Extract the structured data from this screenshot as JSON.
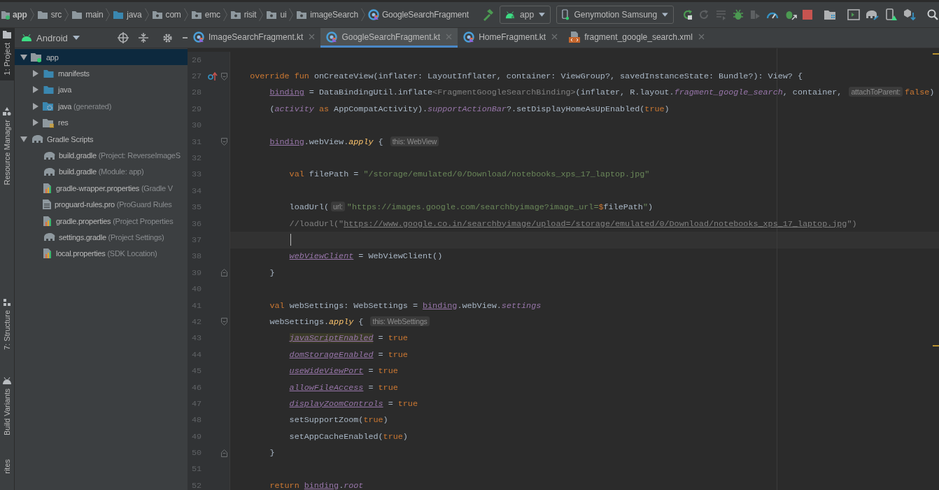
{
  "breadcrumbs": [
    {
      "label": "app",
      "kind": "module"
    },
    {
      "label": "src",
      "kind": "folder"
    },
    {
      "label": "main",
      "kind": "folder"
    },
    {
      "label": "java",
      "kind": "source"
    },
    {
      "label": "com",
      "kind": "package"
    },
    {
      "label": "emc",
      "kind": "package"
    },
    {
      "label": "risit",
      "kind": "package"
    },
    {
      "label": "ui",
      "kind": "package"
    },
    {
      "label": "imageSearch",
      "kind": "package"
    },
    {
      "label": "GoogleSearchFragment",
      "kind": "kotlin"
    }
  ],
  "toolbar": {
    "run_config": "app",
    "device": "Genymotion Samsung"
  },
  "side_tabs": [
    {
      "label": "1: Project",
      "kind": "project",
      "selected": true
    },
    {
      "label": "Resource Manager",
      "kind": "resources",
      "selected": false
    },
    {
      "label": "7: Structure",
      "kind": "structure",
      "selected": false
    },
    {
      "label": "Build Variants",
      "kind": "variants",
      "selected": false
    },
    {
      "label": "rites",
      "kind": "none",
      "selected": false
    }
  ],
  "project_view": {
    "title": "Android"
  },
  "tree": [
    {
      "label": "app",
      "kind": "module",
      "expanded": true,
      "selected": true,
      "children": [
        {
          "label": "manifests",
          "kind": "folder",
          "expanded": false,
          "selected": false
        },
        {
          "label": "java",
          "kind": "folder",
          "expanded": false,
          "selected": false
        },
        {
          "label": "java",
          "note": "(generated)",
          "kind": "generated",
          "expanded": false,
          "selected": false
        },
        {
          "label": "res",
          "kind": "res",
          "expanded": false,
          "selected": false
        }
      ]
    },
    {
      "label": "Gradle Scripts",
      "kind": "gradle",
      "expanded": true,
      "selected": false,
      "children": [
        {
          "label": "build.gradle",
          "note": "(Project: ReverseImageS",
          "kind": "gradle",
          "selected": false
        },
        {
          "label": "build.gradle",
          "note": "(Module: app)",
          "kind": "gradle",
          "selected": false
        },
        {
          "label": "gradle-wrapper.properties",
          "note": "(Gradle V",
          "kind": "properties",
          "selected": false
        },
        {
          "label": "proguard-rules.pro",
          "note": "(ProGuard Rules",
          "kind": "file",
          "selected": false
        },
        {
          "label": "gradle.properties",
          "note": "(Project Properties",
          "kind": "properties",
          "selected": false
        },
        {
          "label": "settings.gradle",
          "note": "(Project Settings)",
          "kind": "gradle",
          "selected": false
        },
        {
          "label": "local.properties",
          "note": "(SDK Location)",
          "kind": "properties",
          "selected": false
        }
      ]
    }
  ],
  "editor_tabs": [
    {
      "label": "ImageSearchFragment.kt",
      "kind": "kotlin",
      "selected": false
    },
    {
      "label": "GoogleSearchFragment.kt",
      "kind": "kotlin",
      "selected": true
    },
    {
      "label": "HomeFragment.kt",
      "kind": "kotlin",
      "selected": false
    },
    {
      "label": "fragment_google_search.xml",
      "kind": "xml",
      "selected": false
    }
  ],
  "code_lines": [
    {
      "number": "26"
    },
    {
      "number": "27",
      "override_marker": true,
      "fold_start": true,
      "tokens": [
        {
          "kind": "keyword",
          "text": "override fun "
        },
        {
          "kind": "plain",
          "text": "onCreateView(inflater: LayoutInflater, container: ViewGroup?, savedInstanceState: Bundle?): View? {"
        }
      ]
    },
    {
      "number": "28",
      "tokens": [
        {
          "kind": "field",
          "text": "binding"
        },
        {
          "kind": "plain",
          "text": " = DataBindingUtil.inflate"
        },
        {
          "kind": "grey",
          "text": "<FragmentGoogleSearchBinding>"
        },
        {
          "kind": "plain",
          "text": "(inflater, R.layout."
        },
        {
          "kind": "italic",
          "text": "fragment_google_search"
        },
        {
          "kind": "plain",
          "text": ", container, "
        },
        {
          "kind": "hint",
          "text": "attachToParent:"
        },
        {
          "kind": "keyword",
          "text": "false"
        },
        {
          "kind": "plain",
          "text": ")"
        }
      ]
    },
    {
      "number": "29",
      "tokens": [
        {
          "kind": "plain",
          "text": "("
        },
        {
          "kind": "italic",
          "text": "activity"
        },
        {
          "kind": "keyword",
          "text": " as "
        },
        {
          "kind": "plain",
          "text": "AppCompatActivity)."
        },
        {
          "kind": "italic",
          "text": "supportActionBar"
        },
        {
          "kind": "plain",
          "text": "?.setDisplayHomeAsUpEnabled("
        },
        {
          "kind": "keyword",
          "text": "true"
        },
        {
          "kind": "plain",
          "text": ")"
        }
      ]
    },
    {
      "number": "30"
    },
    {
      "number": "31",
      "fold_start": true,
      "tokens": [
        {
          "kind": "field",
          "text": "binding"
        },
        {
          "kind": "plain",
          "text": ".webView."
        },
        {
          "kind": "ext",
          "text": "apply"
        },
        {
          "kind": "plain",
          "text": " { "
        },
        {
          "kind": "hint",
          "text": "this: WebView"
        }
      ]
    },
    {
      "number": "32"
    },
    {
      "number": "33",
      "tokens": [
        {
          "kind": "keyword",
          "text": "val "
        },
        {
          "kind": "plain",
          "text": "filePath = "
        },
        {
          "kind": "string",
          "text": "\"/storage/emulated/0/Download/notebooks_xps_17_laptop.jpg\""
        }
      ]
    },
    {
      "number": "34"
    },
    {
      "number": "35",
      "tokens": [
        {
          "kind": "plain",
          "text": "loadUrl("
        },
        {
          "kind": "hint",
          "text": "url:"
        },
        {
          "kind": "string",
          "text": "\"https://images.google.com/searchbyimage?image_url="
        },
        {
          "kind": "keyword",
          "text": "$"
        },
        {
          "kind": "plain",
          "text": "filePath"
        },
        {
          "kind": "string",
          "text": "\""
        },
        {
          "kind": "plain",
          "text": ")"
        }
      ]
    },
    {
      "number": "36",
      "tokens": [
        {
          "kind": "comment",
          "text": "//loadUrl(\""
        },
        {
          "kind": "link",
          "text": "https://www.google.co.in/searchbyimage/upload=/storage/emulated/0/Download/notebooks_xps_17_laptop.jpg"
        },
        {
          "kind": "comment",
          "text": "\")"
        }
      ]
    },
    {
      "number": "37",
      "current": true
    },
    {
      "number": "38",
      "tokens": [
        {
          "kind": "synthetic",
          "text": "webViewClient"
        },
        {
          "kind": "plain",
          "text": " = WebViewClient()"
        }
      ]
    },
    {
      "number": "39",
      "fold_end": true,
      "tokens": [
        {
          "kind": "plain",
          "text": "}"
        }
      ]
    },
    {
      "number": "40"
    },
    {
      "number": "41",
      "tokens": [
        {
          "kind": "keyword",
          "text": "val "
        },
        {
          "kind": "plain",
          "text": "webSettings: WebSettings = "
        },
        {
          "kind": "field",
          "text": "binding"
        },
        {
          "kind": "plain",
          "text": ".webView."
        },
        {
          "kind": "italic",
          "text": "settings"
        }
      ]
    },
    {
      "number": "42",
      "fold_start": true,
      "tokens": [
        {
          "kind": "plain",
          "text": "webSettings."
        },
        {
          "kind": "ext",
          "text": "apply"
        },
        {
          "kind": "plain",
          "text": " { "
        },
        {
          "kind": "hint",
          "text": "this: WebSettings"
        }
      ]
    },
    {
      "number": "43",
      "tokens": [
        {
          "kind": "marked",
          "text": "javaScriptEnabled"
        },
        {
          "kind": "plain",
          "text": " = "
        },
        {
          "kind": "keyword",
          "text": "true"
        }
      ]
    },
    {
      "number": "44",
      "tokens": [
        {
          "kind": "synthetic",
          "text": "domStorageEnabled"
        },
        {
          "kind": "plain",
          "text": " = "
        },
        {
          "kind": "keyword",
          "text": "true"
        }
      ]
    },
    {
      "number": "45",
      "tokens": [
        {
          "kind": "synthetic",
          "text": "useWideViewPort"
        },
        {
          "kind": "plain",
          "text": " = "
        },
        {
          "kind": "keyword",
          "text": "true"
        }
      ]
    },
    {
      "number": "46",
      "tokens": [
        {
          "kind": "synthetic",
          "text": "allowFileAccess"
        },
        {
          "kind": "plain",
          "text": " = "
        },
        {
          "kind": "keyword",
          "text": "true"
        }
      ]
    },
    {
      "number": "47",
      "tokens": [
        {
          "kind": "synthetic",
          "text": "displayZoomControls"
        },
        {
          "kind": "plain",
          "text": " = "
        },
        {
          "kind": "keyword",
          "text": "true"
        }
      ]
    },
    {
      "number": "48",
      "tokens": [
        {
          "kind": "plain",
          "text": "setSupportZoom("
        },
        {
          "kind": "keyword",
          "text": "true"
        },
        {
          "kind": "plain",
          "text": ")"
        }
      ]
    },
    {
      "number": "49",
      "tokens": [
        {
          "kind": "plain",
          "text": "setAppCacheEnabled("
        },
        {
          "kind": "keyword",
          "text": "true"
        },
        {
          "kind": "plain",
          "text": ")"
        }
      ]
    },
    {
      "number": "50",
      "fold_end": true,
      "tokens": [
        {
          "kind": "plain",
          "text": "}"
        }
      ]
    },
    {
      "number": "51"
    },
    {
      "number": "52",
      "tokens": [
        {
          "kind": "keyword",
          "text": "return "
        },
        {
          "kind": "field",
          "text": "binding"
        },
        {
          "kind": "plain",
          "text": "."
        },
        {
          "kind": "italic",
          "text": "root"
        }
      ]
    }
  ]
}
